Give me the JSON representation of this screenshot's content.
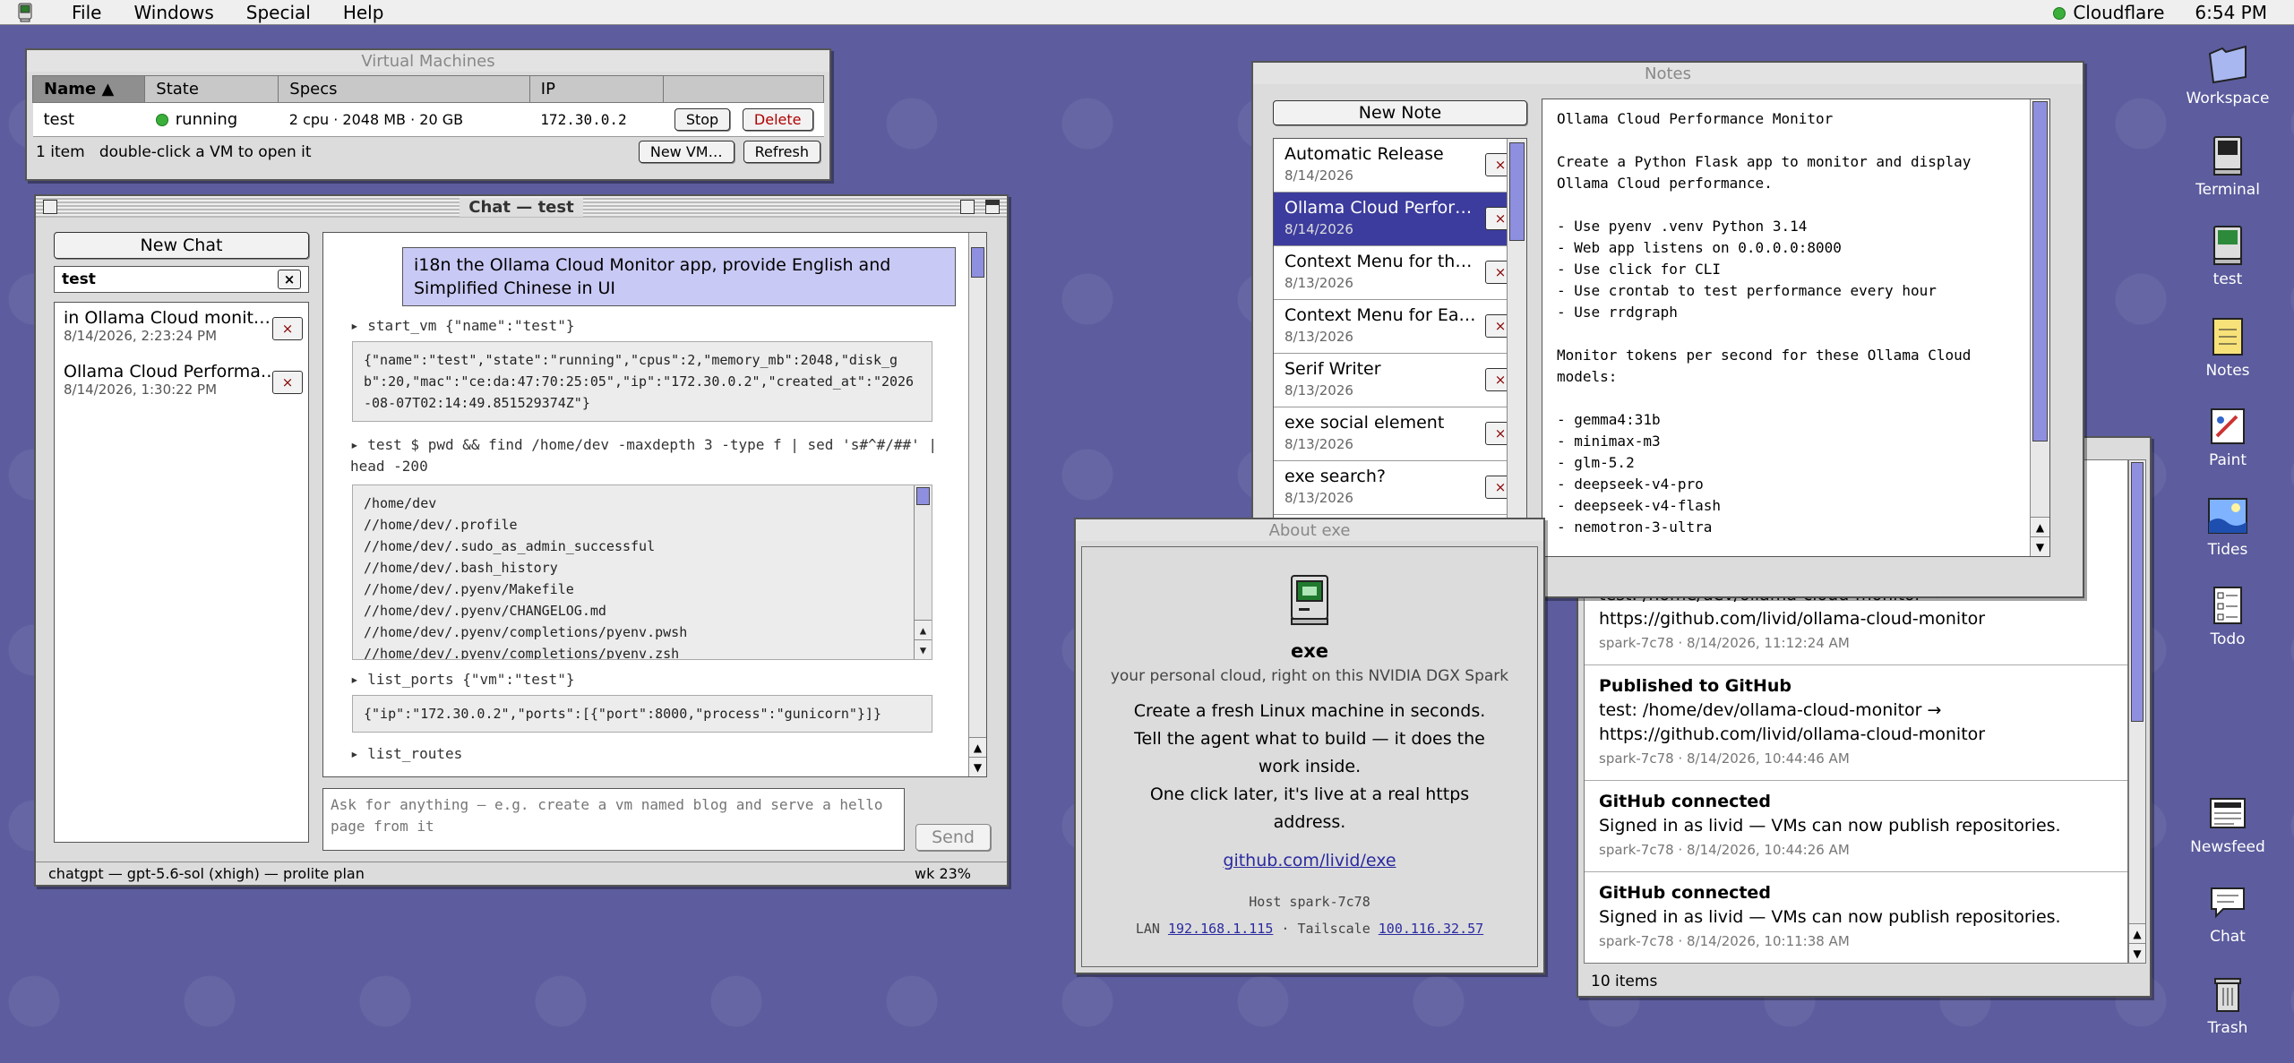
{
  "menubar": {
    "items": [
      "File",
      "Windows",
      "Special",
      "Help"
    ],
    "network": "Cloudflare",
    "time": "6:54 PM"
  },
  "vm_window": {
    "title": "Virtual Machines",
    "columns": [
      "Name ▲",
      "State",
      "Specs",
      "IP"
    ],
    "rows": [
      {
        "name": "test",
        "state": "running",
        "specs": "2 cpu · 2048 MB · 20 GB",
        "ip": "172.30.0.2",
        "stop": "Stop",
        "delete": "Delete"
      }
    ],
    "footer": "1 item   double-click a VM to open it",
    "new_vm": "New VM…",
    "refresh": "Refresh"
  },
  "chat_window": {
    "title": "Chat — test",
    "new_chat": "New Chat",
    "search_value": "test",
    "chats": [
      {
        "title": "in Ollama Cloud monit…",
        "date": "8/14/2026, 2:23:24 PM"
      },
      {
        "title": "Ollama Cloud Performa…",
        "date": "8/14/2026, 1:30:22 PM"
      }
    ],
    "user_message": "i18n the Ollama Cloud Monitor app, provide English and Simplified Chinese in UI",
    "tool1_call": "▸ start_vm {\"name\":\"test\"}",
    "tool1_output": "{\"name\":\"test\",\"state\":\"running\",\"cpus\":2,\"memory_mb\":2048,\"disk_gb\":20,\"mac\":\"ce:da:47:70:25:05\",\"ip\":\"172.30.0.2\",\"created_at\":\"2026-08-07T02:14:49.851529374Z\"}",
    "tool2_call": "▸ test $ pwd && find /home/dev -maxdepth 3 -type f | sed 's#^#/##' | head -200",
    "tool2_lines": [
      "/home/dev",
      "//home/dev/.profile",
      "//home/dev/.sudo_as_admin_successful",
      "//home/dev/.bash_history",
      "//home/dev/.pyenv/Makefile",
      "//home/dev/.pyenv/CHANGELOG.md",
      "//home/dev/.pyenv/completions/pyenv.pwsh",
      "//home/dev/.pyenv/completions/pyenv.zsh"
    ],
    "tool3_call": "▸ list_ports {\"vm\":\"test\"}",
    "tool3_output": "{\"ip\":\"172.30.0.2\",\"ports\":[{\"port\":8000,\"process\":\"gunicorn\"}]}",
    "tool4_call": "▸ list_routes",
    "input_placeholder": "Ask for anything — e.g. create a vm named blog and serve a hello page from it",
    "send": "Send",
    "status_left": "chatgpt — gpt-5.6-sol (xhigh) — prolite plan",
    "status_right": "wk 23%"
  },
  "notes_window": {
    "title": "Notes",
    "new_note": "New Note",
    "notes": [
      {
        "title": "Automatic Release",
        "date": "8/14/2026"
      },
      {
        "title": "Ollama Cloud Perfor…",
        "date": "8/14/2026"
      },
      {
        "title": "Context Menu for th…",
        "date": "8/13/2026"
      },
      {
        "title": "Context Menu for Ea…",
        "date": "8/13/2026"
      },
      {
        "title": "Serif Writer",
        "date": "8/13/2026"
      },
      {
        "title": "exe social element",
        "date": "8/13/2026"
      },
      {
        "title": "exe search?",
        "date": "8/13/2026"
      }
    ],
    "body_lines": [
      "Ollama Cloud Performance Monitor",
      "",
      "Create a Python Flask app to monitor and display",
      "Ollama Cloud performance.",
      "",
      "- Use pyenv .venv Python 3.14",
      "- Web app listens on 0.0.0.0:8000",
      "- Use click for CLI",
      "- Use crontab to test performance every hour",
      "- Use rrdgraph",
      "",
      "Monitor tokens per second for these Ollama Cloud",
      "models:",
      "",
      "- gemma4:31b",
      "- minimax-m3",
      "- glm-5.2",
      "- deepseek-v4-pro",
      "- deepseek-v4-flash",
      "- nemotron-3-ultra"
    ]
  },
  "newsfeed_window": {
    "items": [
      {
        "heading": "",
        "body": "test: /home/dev/ollama-cloud-monitor → https://github.com/livid/ollama-cloud-monitor",
        "meta": "spark-7c78 · 8/14/2026, 11:12:24 AM"
      },
      {
        "heading": "Published to GitHub",
        "body": "test: /home/dev/ollama-cloud-monitor → https://github.com/livid/ollama-cloud-monitor",
        "meta": "spark-7c78 · 8/14/2026, 10:44:46 AM"
      },
      {
        "heading": "GitHub connected",
        "body": "Signed in as livid — VMs can now publish repositories.",
        "meta": "spark-7c78 · 8/14/2026, 10:44:26 AM"
      },
      {
        "heading": "GitHub connected",
        "body": "Signed in as livid — VMs can now publish repositories.",
        "meta": "spark-7c78 · 8/14/2026, 10:11:38 AM"
      }
    ],
    "footer": "10 items"
  },
  "about_window": {
    "title": "About exe",
    "app_name": "exe",
    "tagline": "your personal cloud, right on this NVIDIA DGX Spark",
    "lines": [
      "Create a fresh Linux machine in seconds.",
      "Tell the agent what to build — it does the work inside.",
      "One click later, it's live at a real https address."
    ],
    "link": "github.com/livid/exe",
    "host_label": "Host",
    "host": "spark-7c78",
    "lan_label": "LAN",
    "lan": "192.168.1.115",
    "tailscale_label": "Tailscale",
    "tailscale": "100.116.32.57"
  },
  "desktop_icons": [
    "Workspace",
    "Terminal",
    "test",
    "Notes",
    "Paint",
    "Tides",
    "Todo",
    "Newsfeed",
    "Chat",
    "Trash"
  ],
  "colors": {
    "desktop": "#5c5c9e",
    "selection": "#3c3c9e",
    "scroll_thumb": "#8f8fe0",
    "running": "#3ab03a",
    "delete": "#b00000",
    "bubble": "#c9c9f5"
  }
}
